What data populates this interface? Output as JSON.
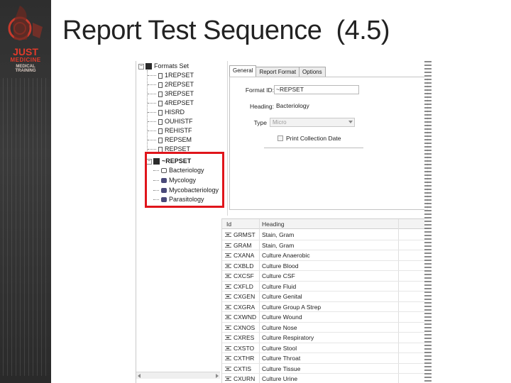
{
  "slide": {
    "title": "Report Test Sequence  (4.5)"
  },
  "logo": {
    "line1": "JUST",
    "line2": "MEDICINE",
    "line3": "MEDICAL TRAINING"
  },
  "tree": {
    "root_label": "Formats Set",
    "items": [
      {
        "label": "1REPSET"
      },
      {
        "label": "2REPSET"
      },
      {
        "label": "3REPSET"
      },
      {
        "label": "4REPSET"
      },
      {
        "label": "HISRD"
      },
      {
        "label": "OUHISTF"
      },
      {
        "label": "REHISTF"
      },
      {
        "label": "REPSEM"
      },
      {
        "label": "REPSET"
      }
    ],
    "expanded_label": "~REPSET",
    "children": [
      {
        "label": "Bacteriology"
      },
      {
        "label": "Mycology"
      },
      {
        "label": "Mycobacteriology"
      },
      {
        "label": "Parasitology"
      }
    ]
  },
  "tabs": [
    {
      "label": "General"
    },
    {
      "label": "Report Format"
    },
    {
      "label": "Options"
    }
  ],
  "form": {
    "format_id_label": "Format ID:",
    "format_id_value": "~REPSET",
    "heading_label": "Heading:",
    "heading_value": "Bacteriology",
    "type_label": "Type",
    "type_value": "Micro",
    "print_collection_label": "Print Collection Date"
  },
  "table": {
    "columns": [
      "Id",
      "Heading"
    ],
    "rows": [
      {
        "id": "GRMST",
        "heading": "Stain, Gram"
      },
      {
        "id": "GRAM",
        "heading": "Stain, Gram"
      },
      {
        "id": "CXANA",
        "heading": "Culture Anaerobic"
      },
      {
        "id": "CXBLD",
        "heading": "Culture Blood"
      },
      {
        "id": "CXCSF",
        "heading": "Culture CSF"
      },
      {
        "id": "CXFLD",
        "heading": "Culture Fluid"
      },
      {
        "id": "CXGEN",
        "heading": "Culture Genital"
      },
      {
        "id": "CXGRA",
        "heading": "Culture Group A Strep"
      },
      {
        "id": "CXWND",
        "heading": "Culture Wound"
      },
      {
        "id": "CXNOS",
        "heading": "Culture Nose"
      },
      {
        "id": "CXRES",
        "heading": "Culture Respiratory"
      },
      {
        "id": "CXSTO",
        "heading": "Culture Stool"
      },
      {
        "id": "CXTHR",
        "heading": "Culture Throat"
      },
      {
        "id": "CXTIS",
        "heading": "Culture Tissue"
      },
      {
        "id": "CXURN",
        "heading": "Culture Urine"
      }
    ]
  },
  "colors": {
    "highlight": "#e0151b",
    "side_band": "#2e2e2e",
    "logo_red": "#e23a2a"
  }
}
